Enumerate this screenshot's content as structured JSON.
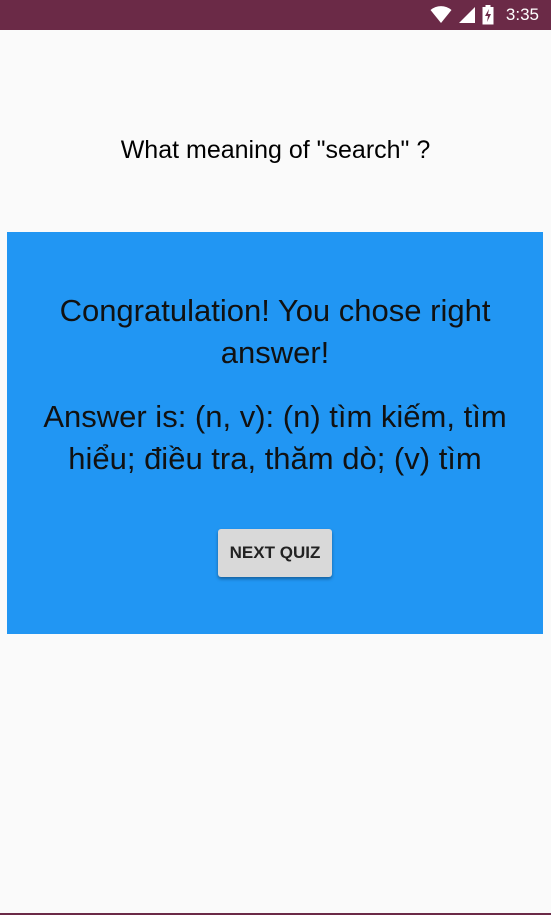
{
  "status_bar": {
    "time": "3:35",
    "icons": [
      "wifi-icon",
      "signal-icon",
      "battery-charging-icon"
    ],
    "color": "#6b2a47"
  },
  "question": {
    "text": "What meaning of \"search\" ?"
  },
  "result": {
    "background": "#2196f3",
    "congratulation_text": "Congratulation! You chose right answer!",
    "answer_text": "Answer is: (n, v): (n) tìm kiếm, tìm hiểu; điều tra, thăm dò; (v) tìm",
    "next_button_label": "NEXT QUIZ"
  }
}
